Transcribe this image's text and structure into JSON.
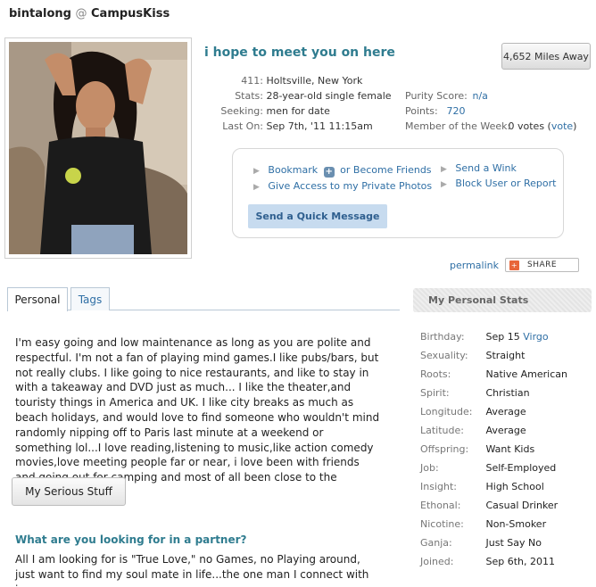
{
  "header": {
    "username": "bintalong",
    "at": "@",
    "site": "CampusKiss"
  },
  "profile": {
    "headline": "i hope to meet you on here",
    "distance": "4,652 Miles Away",
    "details_left": [
      {
        "label": "411:",
        "value": "Holtsville, New York"
      },
      {
        "label": "Stats:",
        "value": "28-year-old single female"
      },
      {
        "label": "Seeking:",
        "value": "men for date"
      },
      {
        "label": "Last On:",
        "value": "Sep 7th, '11 11:15am"
      }
    ],
    "details_right": [
      {
        "label": "Purity Score:",
        "value": "n/a"
      },
      {
        "label": "Points:",
        "value": "720"
      },
      {
        "label": "Member of the Week:",
        "value": "0 votes",
        "link_open": "(",
        "link": "vote",
        "link_close": ")"
      }
    ]
  },
  "actions": {
    "bookmark": "Bookmark",
    "or_become": "or Become Friends",
    "private_photos": "Give Access to my Private Photos",
    "send_wink": "Send a Wink",
    "block": "Block User",
    "or": "or",
    "report": "Report",
    "quick_message": "Send a Quick Message"
  },
  "share": {
    "permalink": "permalink",
    "share_label": "SHARE"
  },
  "tabs": {
    "personal": "Personal",
    "tags": "Tags"
  },
  "about_text": "I'm easy going and low maintenance as long as you are polite and respectful. I'm not a fan of playing mind games.I like pubs/bars, but not really clubs. I like going to nice restaurants, and like to stay in with a takeaway and DVD just as much... I like the theater,and touristy things in America and UK. I like city breaks as much as beach holidays, and would love to find someone who wouldn't mind randomly nipping off to Paris last minute at a weekend or something lol...I love reading,listening to music,like action comedy movies,love meeting people far or near, i love been with friends and going out for camping and most of all been close to the nature..",
  "serious_button": "My Serious Stuff",
  "partner": {
    "heading": "What are you looking for in a partner?",
    "text": "All I am looking for is \"True Love,\" no Games, no Playing around, just want to find my soul mate in life...the one man I connect with in every way"
  },
  "stats": {
    "title": "My Personal Stats",
    "rows": [
      {
        "label": "Birthday:",
        "value": "Sep 15",
        "extra": "Virgo"
      },
      {
        "label": "Sexuality:",
        "value": "Straight"
      },
      {
        "label": "Roots:",
        "value": "Native American"
      },
      {
        "label": "Spirit:",
        "value": "Christian"
      },
      {
        "label": "Longitude:",
        "value": "Average"
      },
      {
        "label": "Latitude:",
        "value": "Average"
      },
      {
        "label": "Offspring:",
        "value": "Want Kids"
      },
      {
        "label": "Job:",
        "value": "Self-Employed"
      },
      {
        "label": "Insight:",
        "value": "High School"
      },
      {
        "label": "Ethonal:",
        "value": "Casual Drinker"
      },
      {
        "label": "Nicotine:",
        "value": "Non-Smoker"
      },
      {
        "label": "Ganja:",
        "value": "Just Say No"
      },
      {
        "label": "Joined:",
        "value": "Sep 6th, 2011"
      }
    ]
  },
  "colors": {
    "link": "#2f6fa5",
    "heading": "#2f7c8f",
    "button_blue": "#c7dbef"
  }
}
